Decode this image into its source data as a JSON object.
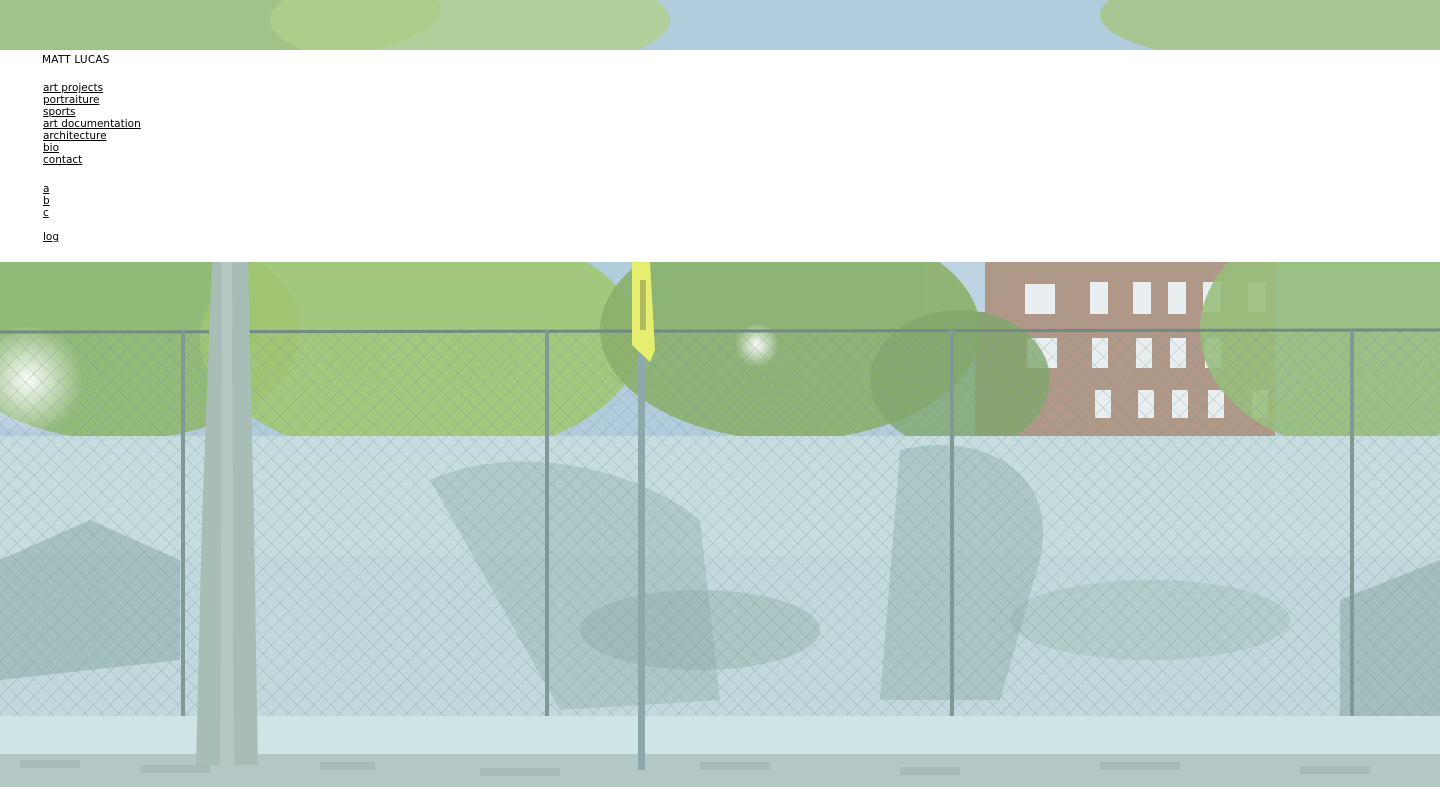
{
  "site": {
    "title": "MATT LUCAS"
  },
  "main_nav": {
    "items": [
      {
        "label": "art projects"
      },
      {
        "label": "portraiture"
      },
      {
        "label": "sports"
      },
      {
        "label": "art documentation"
      },
      {
        "label": "architecture"
      },
      {
        "label": "bio"
      },
      {
        "label": "contact"
      }
    ]
  },
  "sub_nav": {
    "items": [
      {
        "label": "a"
      },
      {
        "label": "b"
      },
      {
        "label": "c"
      }
    ]
  },
  "extra_nav": {
    "items": [
      {
        "label": "log"
      }
    ]
  },
  "colors": {
    "sky": "#a4c4d8",
    "foliage": "#9cc07a",
    "wall": "#b8d2d6",
    "panel": "#ffffff",
    "text": "#000000"
  }
}
